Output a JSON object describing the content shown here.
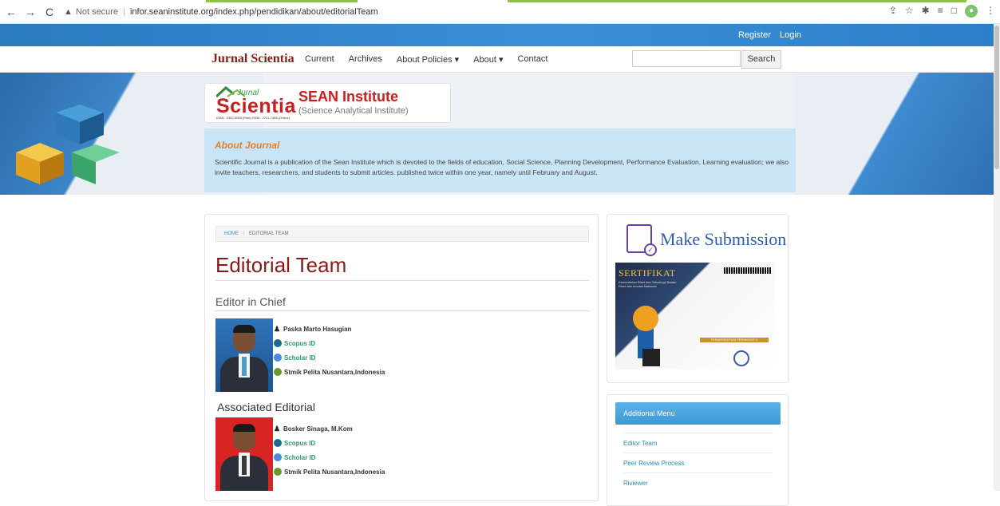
{
  "browser": {
    "security": "Not secure",
    "url": "infor.seaninstitute.org/index.php/pendidikan/about/editorialTeam"
  },
  "topbar": {
    "register": "Register",
    "login": "Login"
  },
  "navbar": {
    "brand": "Jurnal Scientia",
    "items": [
      "Current",
      "Archives",
      "About Policies ▾",
      "About ▾",
      "Contact"
    ],
    "search_label": "Search"
  },
  "banner": {
    "logo_jurnal": "Jurnal",
    "logo_scientia": "Scientia",
    "logo_issn": "ISSN : 2302-0059 (Print) ISSN : 2721-7466 (Online)",
    "logo_sean": "SEAN Institute",
    "logo_sub": "(Science Analytical Institute)",
    "about_title": "About Journal",
    "about_text": "Scientific Journal is a publication of the Sean Institute which is devoted to the fields of education, Social Science, Planning Development, Performance Evaluation, Learning evaluation; we also invite teachers, researchers, and students to submit articles. published twice within one year, namely until February and August."
  },
  "main": {
    "breadcrumb_home": "HOME",
    "breadcrumb_sep": "/",
    "breadcrumb_current": "EDITORIAL TEAM",
    "title": "Editorial Team",
    "section1": "Editor in Chief",
    "chief": {
      "name": "Paska Marto Hasugian",
      "scopus": "Scopus ID",
      "scholar": "Scholar ID",
      "institution": "Stmik Pelita Nusantara,Indonesia"
    },
    "section2": "Associated Editorial",
    "associate": {
      "name": "Bosker Sinaga, M.Kom",
      "scopus": "Scopus ID",
      "scholar": "Scholar ID",
      "institution": "Stmik Pelita Nusantara,Indonesia"
    }
  },
  "sidebar": {
    "make_submission": "Make Submission",
    "certificate_title": "SERTIFIKAT",
    "certificate_sub": "Kementerian Riset dan Teknologi/ Badan Riset dan Inovasi Nasional",
    "certificate_badge": "TERAKREDITASI PERINGKAT 5",
    "additional_menu": "Additional Menu",
    "menu_items": [
      "Editor Team",
      "Peer Review Process",
      "Riviewer"
    ]
  }
}
